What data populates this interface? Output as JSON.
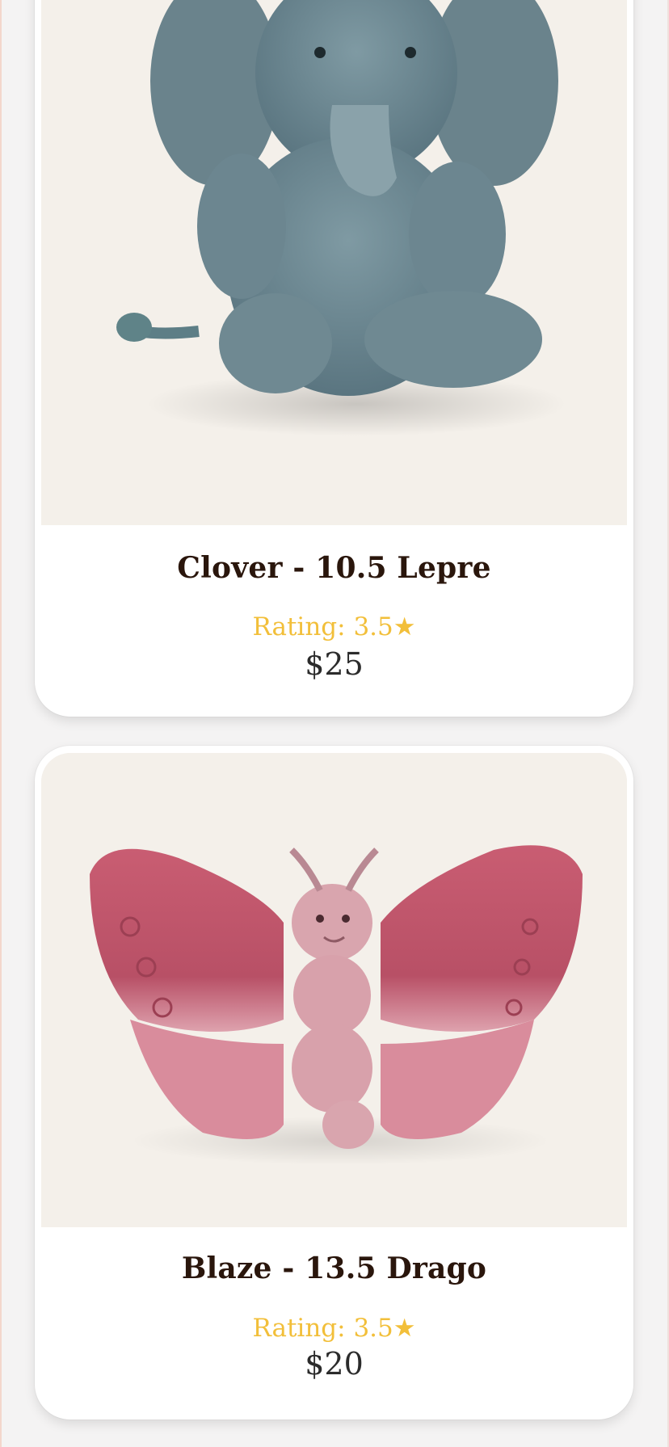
{
  "products": [
    {
      "name": "Clover - 10.5 Lepre",
      "rating_label": "Rating: 3.5★",
      "price": "$25",
      "image_icon": "plush-elephant-image"
    },
    {
      "name": "Blaze - 13.5 Drago",
      "rating_label": "Rating: 3.5★",
      "price": "$20",
      "image_icon": "plush-butterfly-image"
    }
  ],
  "colors": {
    "page_bg": "#f4f3f3",
    "card_bg": "#ffffff",
    "image_bg": "#f4f0ea",
    "title": "#2a160c",
    "rating": "#f2bf3a",
    "price": "#2b2b2b"
  }
}
